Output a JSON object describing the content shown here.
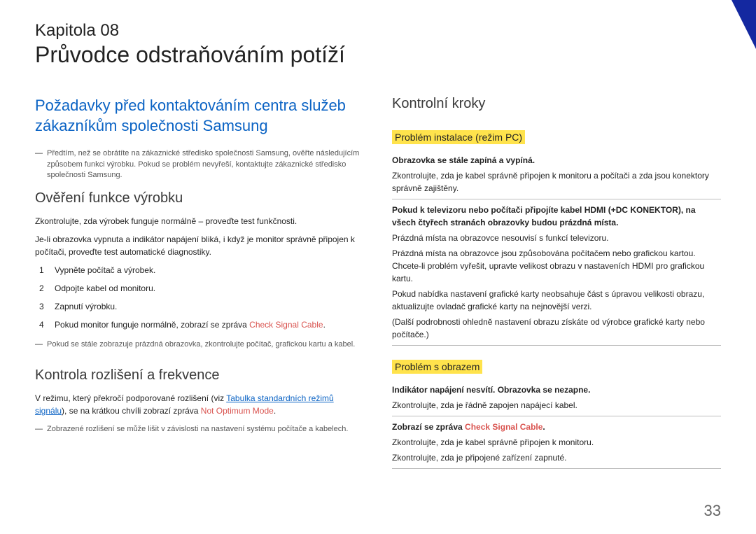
{
  "chapter": {
    "label": "Kapitola 08",
    "title": "Průvodce odstraňováním potíží"
  },
  "left": {
    "mainHeading": "Požadavky před kontaktováním centra služeb zákazníkům společnosti Samsung",
    "preNote": "Předtím, než se obrátíte na zákaznické středisko společnosti Samsung, ověřte následujícím způsobem funkci výrobku. Pokud se problém nevyřeší, kontaktujte zákaznické středisko společnosti Samsung.",
    "sec1": {
      "heading": "Ověření funkce výrobku",
      "p1": "Zkontrolujte, zda výrobek funguje normálně – proveďte test funkčnosti.",
      "p2": "Je-li obrazovka vypnuta a indikátor napájení bliká, i když je monitor správně připojen k počítači, proveďte test automatické diagnostiky.",
      "steps": [
        "Vypněte počítač a výrobek.",
        "Odpojte kabel od monitoru.",
        "Zapnutí výrobku."
      ],
      "step4_pre": "Pokud monitor funguje normálně, zobrazí se zpráva ",
      "step4_red": "Check Signal Cable",
      "note": "Pokud se stále zobrazuje prázdná obrazovka, zkontrolujte počítač, grafickou kartu a kabel."
    },
    "sec2": {
      "heading": "Kontrola rozlišení a frekvence",
      "p1_pre": "V režimu, který překročí podporované rozlišení (viz ",
      "p1_link": "Tabulka standardních režimů signálu",
      "p1_mid": "), se na krátkou chvíli zobrazí zpráva ",
      "p1_red": "Not Optimum Mode",
      "note": "Zobrazené rozlišení se může lišit v závislosti na nastavení systému počítače a kabelech."
    }
  },
  "right": {
    "heading": "Kontrolní kroky",
    "pc": {
      "label": "Problém instalace (režim PC)",
      "b1_title": "Obrazovka se stále zapíná a vypíná.",
      "b1_text": "Zkontrolujte, zda je kabel správně připojen k monitoru a počítači a zda jsou konektory správně zajištěny.",
      "b2_title": "Pokud k televizoru nebo počítači připojíte kabel HDMI (+DC KONEKTOR), na všech čtyřech stranách obrazovky budou prázdná místa.",
      "b2_l1": "Prázdná místa na obrazovce nesouvisí s funkcí televizoru.",
      "b2_l2": "Prázdná místa na obrazovce jsou způsobována počítačem nebo grafickou kartou. Chcete-li problém vyřešit, upravte velikost obrazu v nastaveních HDMI pro grafickou kartu.",
      "b2_l3": "Pokud nabídka nastavení grafické karty neobsahuje část s úpravou velikosti obrazu, aktualizujte ovladač grafické karty na nejnovější verzi.",
      "b2_l4": "(Další podrobnosti ohledně nastavení obrazu získáte od výrobce grafické karty nebo počítače.)"
    },
    "screen": {
      "label": "Problém s obrazem",
      "b1_title": "Indikátor napájení nesvítí. Obrazovka se nezapne.",
      "b1_text": "Zkontrolujte, zda je řádně zapojen napájecí kabel.",
      "b2_pre": "Zobrazí se zpráva ",
      "b2_red": "Check Signal Cable",
      "b2_l1": "Zkontrolujte, zda je kabel správně připojen k monitoru.",
      "b2_l2": "Zkontrolujte, zda je připojené zařízení zapnuté."
    }
  },
  "pageNumber": "33"
}
